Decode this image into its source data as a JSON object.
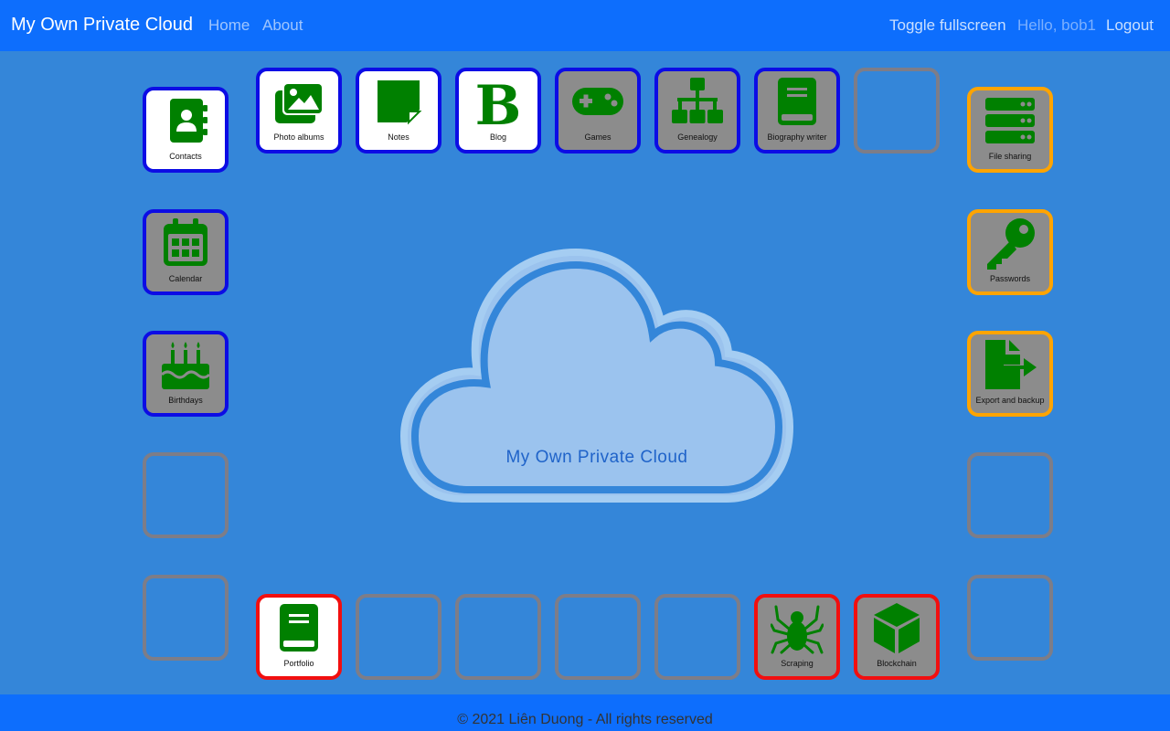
{
  "navbar": {
    "brand": "My Own Private Cloud",
    "links": [
      "Home",
      "About"
    ],
    "toggle_fullscreen": "Toggle fullscreen",
    "greeting": "Hello, bob1",
    "logout": "Logout"
  },
  "center": {
    "title": "My Own Private Cloud"
  },
  "apps": {
    "contacts": "Contacts",
    "photo_albums": "Photo albums",
    "notes": "Notes",
    "blog": "Blog",
    "games": "Games",
    "genealogy": "Genealogy",
    "biography": "Biography writer",
    "calendar": "Calendar",
    "birthdays": "Birthdays",
    "file_sharing": "File sharing",
    "passwords": "Passwords",
    "export_backup": "Export and backup",
    "portfolio": "Portfolio",
    "scraping": "Scraping",
    "blockchain": "Blockchain"
  },
  "footer": {
    "text": "© 2021 Liên Duong - All rights reserved"
  },
  "colors": {
    "navbar": "#0d6efd",
    "background": "#3486d9",
    "icon_green": "#008000",
    "border_blue": "#0c0ce5",
    "border_orange": "#ffa400",
    "border_red": "#f20f0f",
    "border_empty": "#7d7d88"
  },
  "icons": {
    "contacts": "address-book-icon",
    "photo_albums": "images-icon",
    "notes": "sticky-note-icon",
    "blog": "bold-b-icon",
    "games": "gamepad-icon",
    "genealogy": "sitemap-icon",
    "biography": "book-icon",
    "calendar": "calendar-icon",
    "birthdays": "birthday-cake-icon",
    "file_sharing": "server-icon",
    "passwords": "key-icon",
    "export_backup": "file-export-icon",
    "portfolio": "book-icon",
    "scraping": "spider-icon",
    "blockchain": "cube-icon"
  }
}
